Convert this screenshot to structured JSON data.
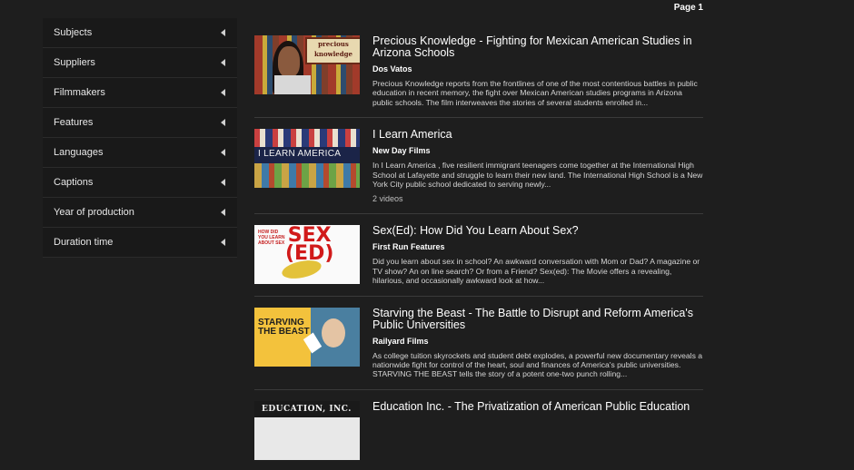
{
  "pagination": {
    "label": "Page 1"
  },
  "filters": [
    {
      "label": "Subjects"
    },
    {
      "label": "Suppliers"
    },
    {
      "label": "Filmmakers"
    },
    {
      "label": "Features"
    },
    {
      "label": "Languages"
    },
    {
      "label": "Captions"
    },
    {
      "label": "Year of production"
    },
    {
      "label": "Duration time"
    }
  ],
  "results": [
    {
      "title": "Precious Knowledge - Fighting for Mexican American Studies in Arizona Schools",
      "supplier": "Dos Vatos",
      "description": "Precious Knowledge reports from the frontlines of one of the most contentious battles in public education in recent memory, the fight over Mexican American studies programs in Arizona public schools. The film interweaves the stories of several students enrolled in...",
      "thumb_text": "precious knowledge"
    },
    {
      "title": "I Learn America",
      "supplier": "New Day Films",
      "description": "In I Learn America , five resilient immigrant teenagers come together at the International High School at Lafayette and struggle to learn their new land. The International High School is a New York City public school dedicated to serving newly...",
      "count": "2 videos",
      "thumb_text": "I LEARN AMERICA"
    },
    {
      "title": "Sex(Ed): How Did You Learn About Sex?",
      "supplier": "First Run Features",
      "description": "Did you learn about sex in school? An awkward conversation with Mom or Dad? A magazine or TV show? An on line search? Or from a Friend? Sex(ed): The Movie offers a revealing, hilarious, and occasionally awkward look at how...",
      "thumb_small": "HOW DID YOU LEARN ABOUT SEX",
      "thumb_big_1": "SEX",
      "thumb_big_2": "(ED)"
    },
    {
      "title": "Starving the Beast - The Battle to Disrupt and Reform America's Public Universities",
      "supplier": "Railyard Films",
      "description": "As college tuition skyrockets and student debt explodes, a powerful new documentary reveals a nationwide fight for control of the heart, soul and finances of America's public universities. STARVING THE BEAST tells the story of a potent one-two punch rolling...",
      "thumb_line_1": "STARVING",
      "thumb_line_2": "THE BEAST"
    },
    {
      "title": "Education Inc. - The Privatization of American Public Education",
      "thumb_text": "EDUCATION, INC."
    }
  ],
  "colors": {
    "background": "#1e1e1e",
    "sidebar": "#191919",
    "divider": "#3a3a3a",
    "text": "#ffffff"
  },
  "icons": {
    "filter_toggle": "caret-left-icon"
  }
}
